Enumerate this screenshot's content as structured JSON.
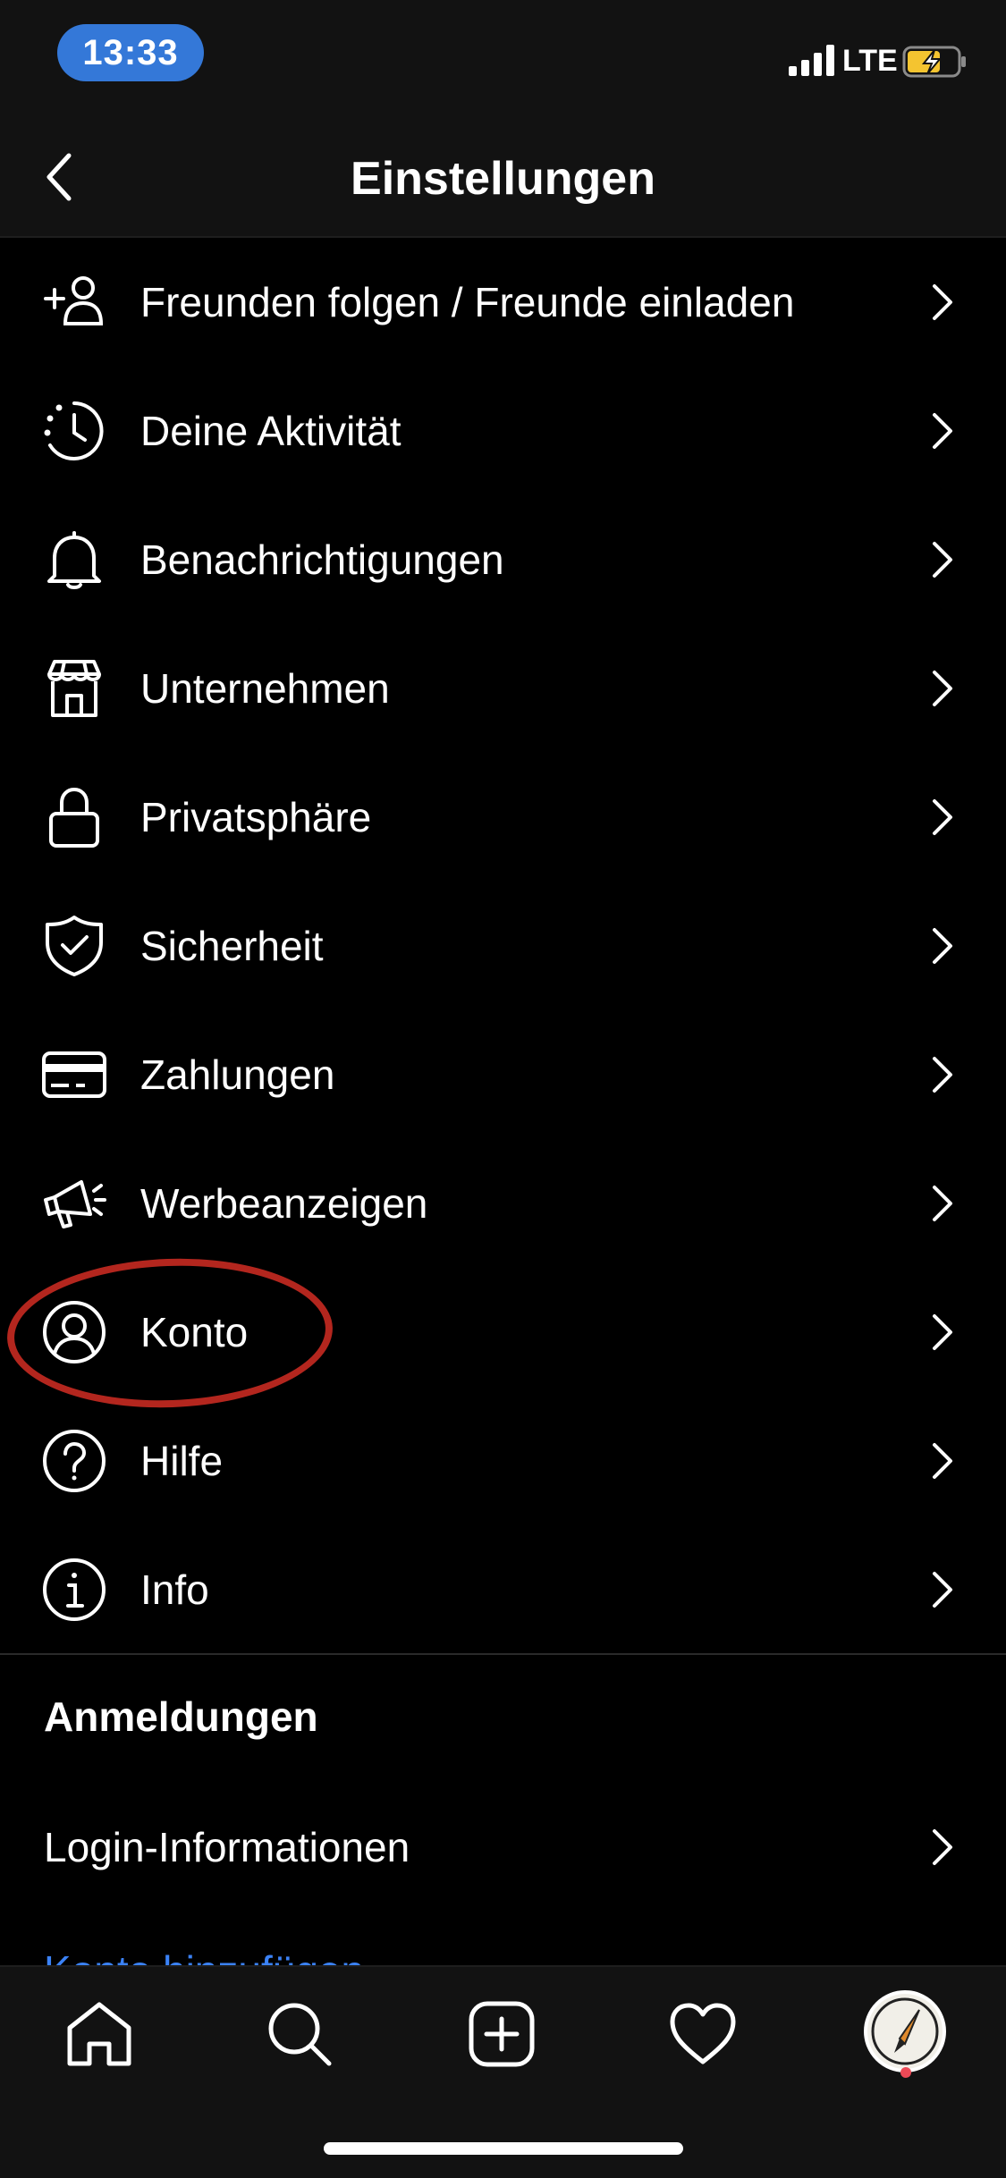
{
  "status_bar": {
    "time": "13:33",
    "network": "LTE",
    "battery_state": "charging"
  },
  "header": {
    "title": "Einstellungen",
    "back_icon": "chevron-left-icon"
  },
  "menu": {
    "items": [
      {
        "label": "Freunden folgen / Freunde einladen",
        "icon": "add-person-icon"
      },
      {
        "label": "Deine Aktivität",
        "icon": "activity-clock-icon"
      },
      {
        "label": "Benachrichtigungen",
        "icon": "bell-icon"
      },
      {
        "label": "Unternehmen",
        "icon": "storefront-icon"
      },
      {
        "label": "Privatsphäre",
        "icon": "lock-icon"
      },
      {
        "label": "Sicherheit",
        "icon": "shield-check-icon"
      },
      {
        "label": "Zahlungen",
        "icon": "credit-card-icon"
      },
      {
        "label": "Werbeanzeigen",
        "icon": "megaphone-icon"
      },
      {
        "label": "Konto",
        "icon": "account-circle-icon"
      },
      {
        "label": "Hilfe",
        "icon": "help-circle-icon"
      },
      {
        "label": "Info",
        "icon": "info-circle-icon"
      }
    ]
  },
  "logins_section": {
    "heading": "Anmeldungen",
    "items": [
      {
        "label": "Login-Informationen"
      }
    ],
    "partial_link": "Konto hinzufügen"
  },
  "annotation": {
    "highlighted_item": "Konto",
    "color": "#b3261e"
  },
  "tab_bar": {
    "tabs": [
      "home-icon",
      "search-icon",
      "new-post-icon",
      "activity-heart-icon",
      "profile-avatar"
    ]
  },
  "colors": {
    "background": "#000000",
    "bar_background": "#121212",
    "time_pill": "#3478d8",
    "link": "#3b82f6",
    "notification_dot": "#ed4956"
  }
}
